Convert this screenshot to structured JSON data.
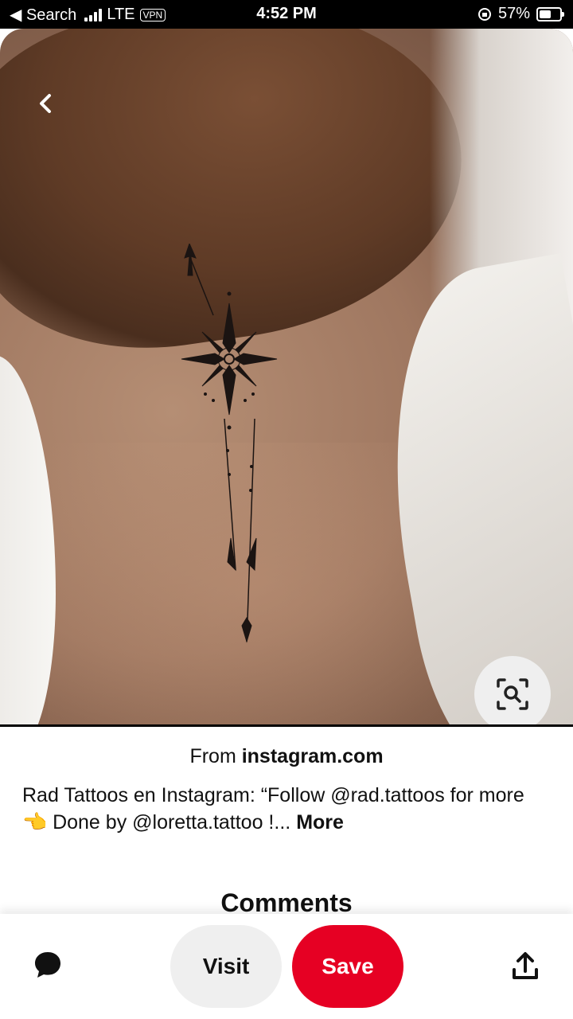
{
  "status_bar": {
    "back_label": "◀ Search",
    "carrier": "LTE",
    "vpn": "VPN",
    "time": "4:52 PM",
    "battery": "57%"
  },
  "pin": {
    "image_description": "",
    "source_prefix": "From ",
    "source_domain": "instagram.com",
    "description": "Rad Tattoos en Instagram: “Follow @rad.tattoos for more 👈 Done by @loretta.tattoo !...",
    "more_label": "More"
  },
  "comments": {
    "title": "Comments"
  },
  "actions": {
    "visit_label": "Visit",
    "save_label": "Save"
  },
  "icons": {
    "back": "chevron-left-icon",
    "lens": "visual-search-icon",
    "chat": "chat-bubble-icon",
    "share": "share-upload-icon"
  },
  "colors": {
    "save_red": "#e60023",
    "visit_gray": "#efefef"
  }
}
